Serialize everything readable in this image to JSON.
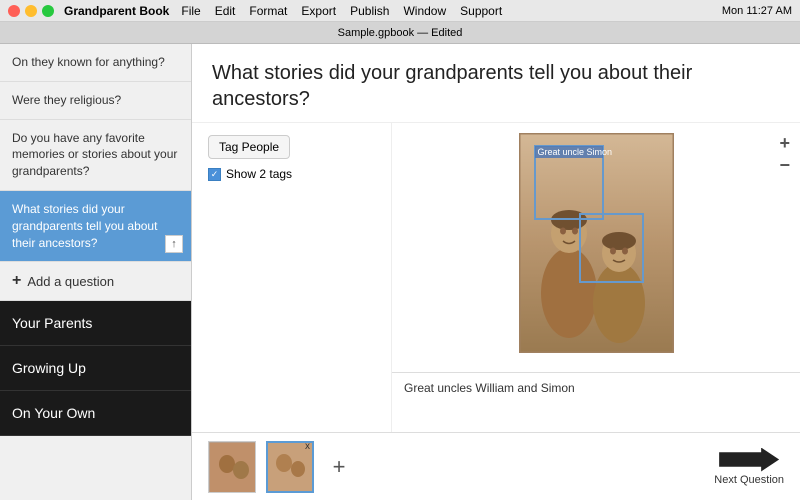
{
  "menubar": {
    "app_name": "Grandparent Book",
    "menus": [
      "File",
      "Edit",
      "Format",
      "Export",
      "Publish",
      "Window",
      "Support"
    ],
    "tab_label": "Sample.gpbook — Edited",
    "time": "Mon 11:27 AM"
  },
  "sidebar": {
    "questions": [
      {
        "id": "q1",
        "text": "On they known for anything?",
        "active": false
      },
      {
        "id": "q2",
        "text": "Were they religious?",
        "active": false
      },
      {
        "id": "q3",
        "text": "Do you have any favorite memories or stories about your grandparents?",
        "active": false
      },
      {
        "id": "q4",
        "text": "What stories did your grandparents tell you about their ancestors?",
        "active": true
      }
    ],
    "add_question_label": "Add a question",
    "sections": [
      {
        "id": "your-parents",
        "label": "Your Parents"
      },
      {
        "id": "growing-up",
        "label": "Growing Up"
      },
      {
        "id": "on-your-own",
        "label": "On Your Own"
      }
    ]
  },
  "content": {
    "title": "What stories did your grandparents tell you about their ancestors?",
    "tag_people_label": "Tag People",
    "show_tags_label": "Show 2 tags",
    "show_tags_checked": true,
    "photo": {
      "tag1_label": "Great uncle Simon",
      "caption": "Great uncles William and Simon"
    },
    "plus_btn": "+",
    "minus_btn": "−"
  },
  "bottom": {
    "add_photo_symbol": "+",
    "next_question_label": "Next Question",
    "thumb_x": "x"
  }
}
